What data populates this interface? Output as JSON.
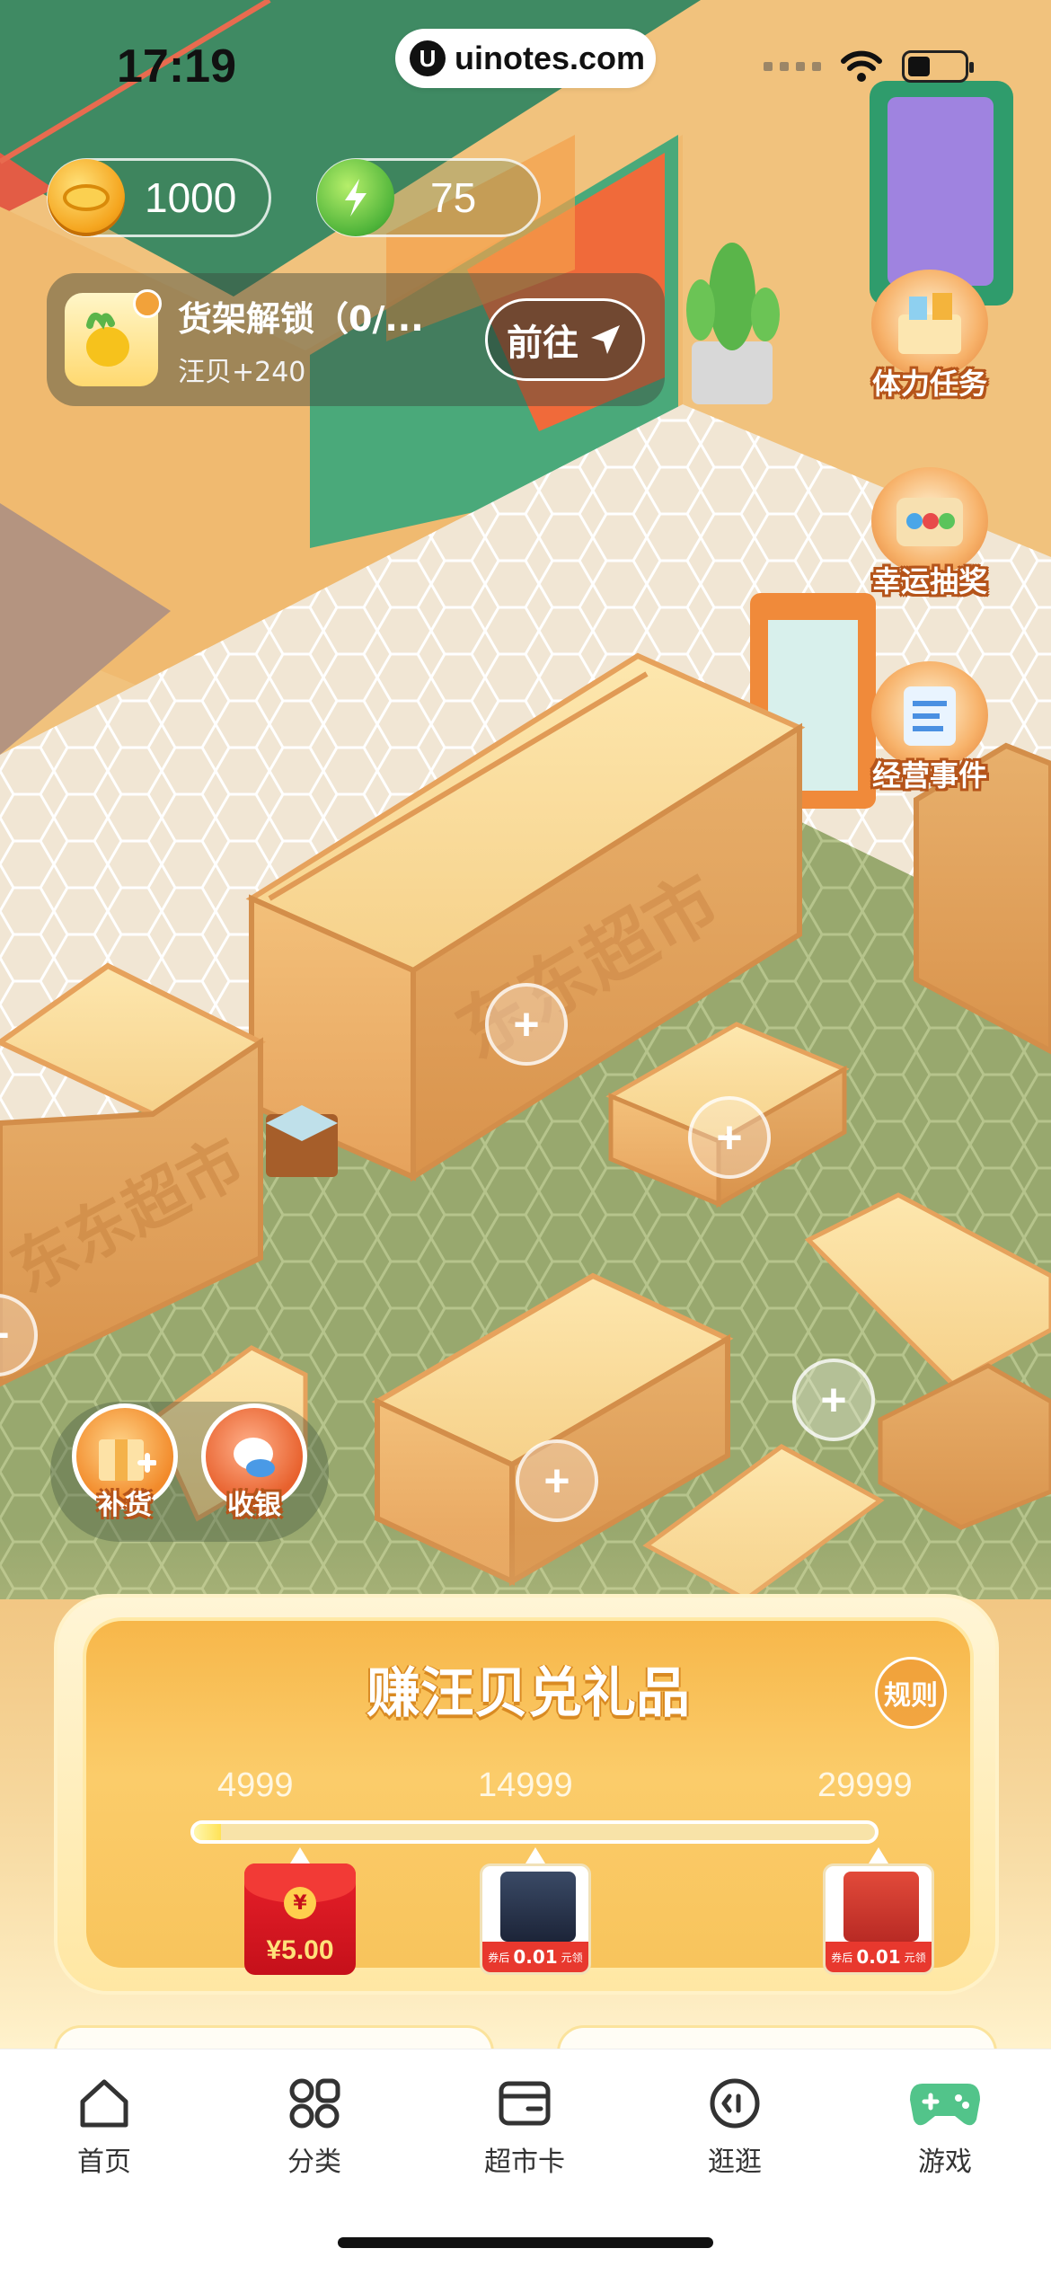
{
  "status_bar": {
    "time": "17:19",
    "url": "uinotes.com",
    "url_logo": "U"
  },
  "resources": {
    "coins": "1000",
    "energy": "75",
    "coin_icon": "gold-coin-icon",
    "energy_icon": "green-apple-energy-icon"
  },
  "quest": {
    "title": "货架解锁（0/...",
    "reward": "汪贝+240",
    "go_label": "前往"
  },
  "side_features": [
    {
      "label": "体力任务",
      "icon": "stamina-task-icon"
    },
    {
      "label": "幸运抽奖",
      "icon": "lucky-draw-icon"
    },
    {
      "label": "经营事件",
      "icon": "business-event-icon"
    }
  ],
  "actions": {
    "restock_label": "补货",
    "cashier_label": "收银"
  },
  "scene": {
    "crate_text": "东东超市",
    "plus_symbol": "+"
  },
  "reward_panel": {
    "title": "赚汪贝兑礼品",
    "rules_label": "规则",
    "progress": 0.04,
    "milestones": [
      "4999",
      "14999",
      "29999"
    ],
    "items": [
      {
        "kind": "red-packet",
        "seal": "¥",
        "amount": "¥5.00"
      },
      {
        "kind": "product",
        "prefix": "券后",
        "price": "0.01",
        "unit": "元领"
      },
      {
        "kind": "product",
        "prefix": "券后",
        "price": "0.01",
        "unit": "元领"
      }
    ]
  },
  "tabs": [
    {
      "label": "首页",
      "icon": "home-icon"
    },
    {
      "label": "分类",
      "icon": "category-icon"
    },
    {
      "label": "超市卡",
      "icon": "card-wallet-icon"
    },
    {
      "label": "逛逛",
      "icon": "browse-icon"
    },
    {
      "label": "游戏",
      "icon": "gamepad-icon",
      "active": true
    }
  ],
  "colors": {
    "accent_orange": "#f7b74a",
    "game_green": "#52c48a",
    "red_packet": "#d8121e"
  }
}
